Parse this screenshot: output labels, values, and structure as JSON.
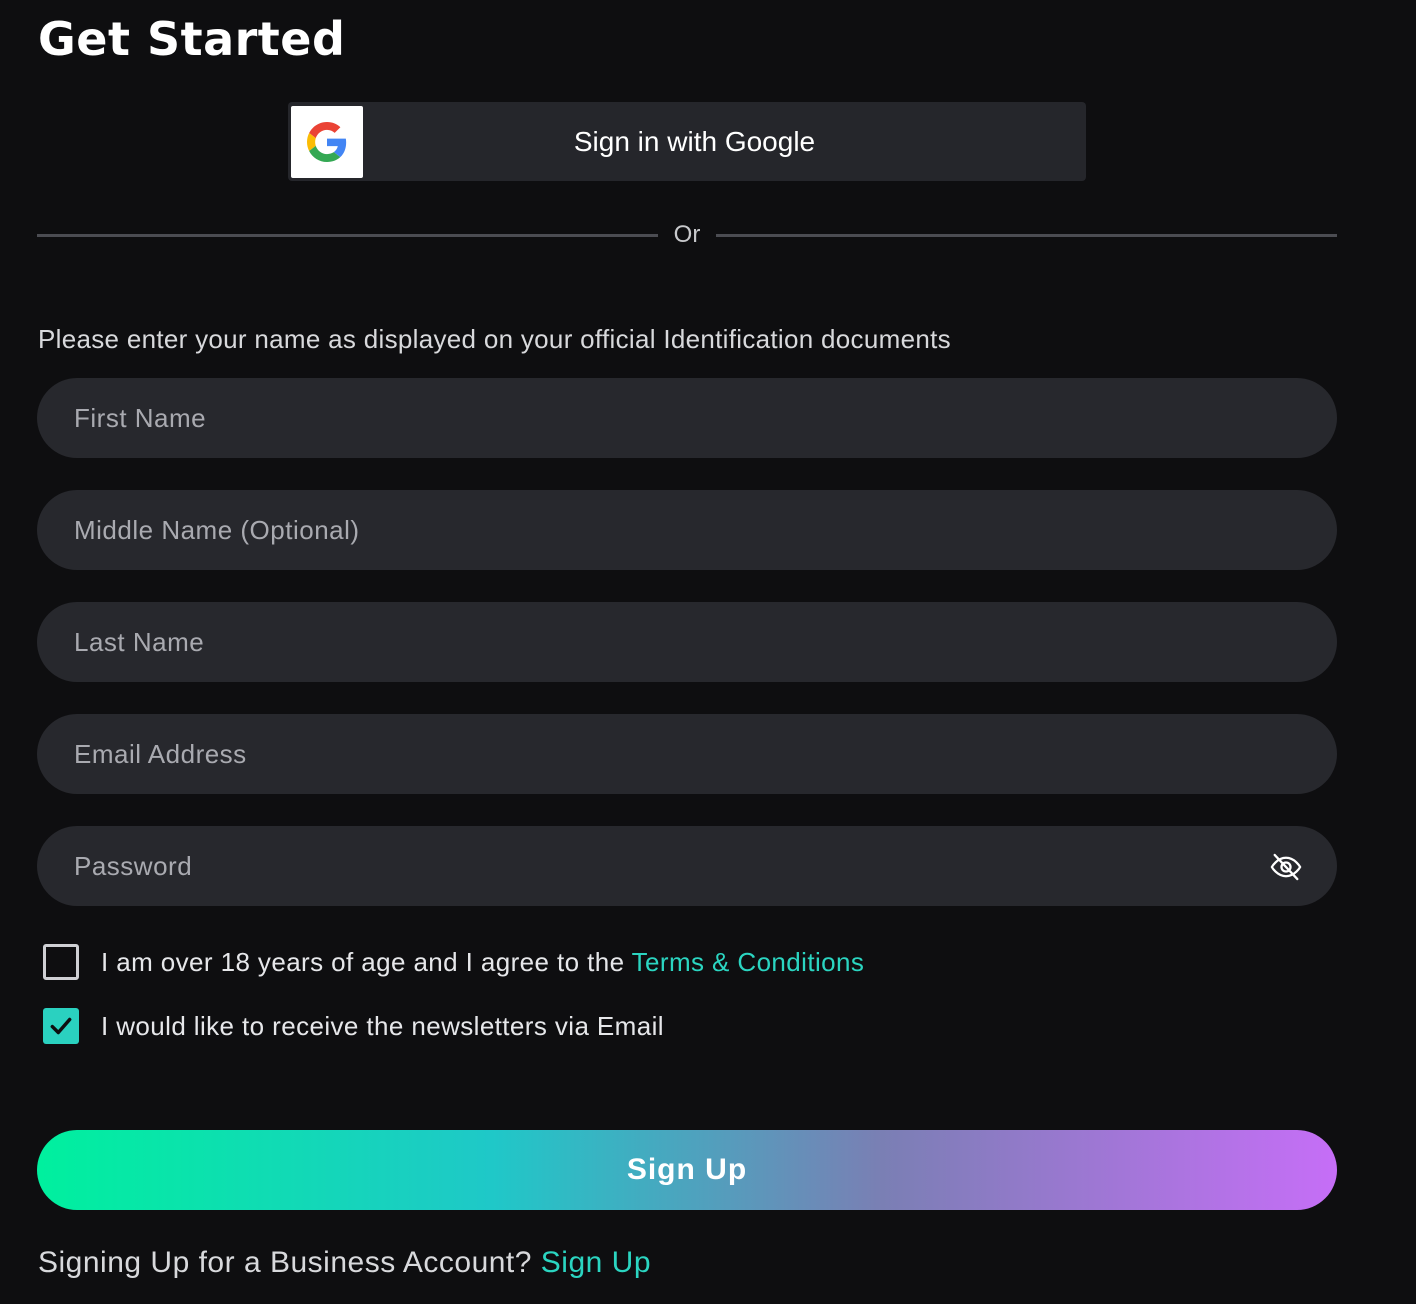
{
  "header": {
    "title": "Get Started"
  },
  "google": {
    "label": "Sign in with Google"
  },
  "divider": {
    "text": "Or"
  },
  "form": {
    "hint": "Please enter your name as displayed on your official Identification documents",
    "first_name": {
      "placeholder": "First Name",
      "value": ""
    },
    "middle_name": {
      "placeholder": "Middle Name (Optional)",
      "value": ""
    },
    "last_name": {
      "placeholder": "Last Name",
      "value": ""
    },
    "email": {
      "placeholder": "Email Address",
      "value": ""
    },
    "password": {
      "placeholder": "Password",
      "value": "",
      "toggle_icon": "eye-off-icon"
    }
  },
  "consents": {
    "terms": {
      "checked": false,
      "text": "I am over 18 years of age and I agree to the ",
      "link": "Terms & Conditions"
    },
    "newsletter": {
      "checked": true,
      "text": "I would like to receive the newsletters via Email"
    }
  },
  "signup": {
    "label": "Sign Up"
  },
  "business": {
    "text": "Signing Up for a Business Account? ",
    "link": "Sign Up"
  },
  "colors": {
    "background": "#0e0e10",
    "field": "#27282d",
    "accent": "#2bd5c1",
    "gradient_start": "#00f09e",
    "gradient_end": "#c66ef7"
  }
}
